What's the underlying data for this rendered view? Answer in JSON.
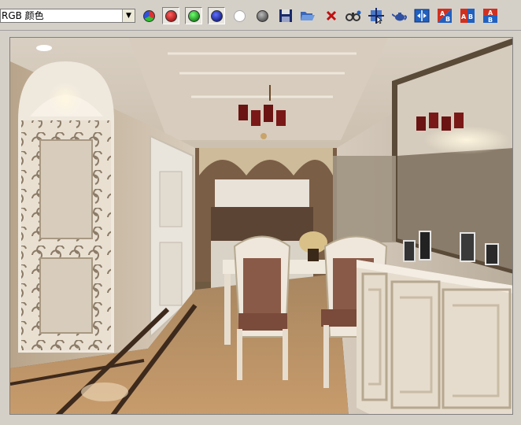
{
  "toolbar": {
    "channel_select": {
      "value": "RGB 颜色"
    },
    "buttons": [
      {
        "name": "rgb-channel-icon",
        "icon": "rgb-circle"
      },
      {
        "name": "red-channel-icon",
        "icon": "red-circle"
      },
      {
        "name": "green-channel-icon",
        "icon": "green-circle"
      },
      {
        "name": "blue-channel-icon",
        "icon": "blue-circle"
      },
      {
        "name": "mono-icon",
        "icon": "white-circle"
      },
      {
        "name": "clear-icon",
        "icon": "gray-circle"
      },
      {
        "name": "save-icon",
        "icon": "floppy"
      },
      {
        "name": "open-icon",
        "icon": "folder"
      },
      {
        "name": "close-icon",
        "icon": "red-x"
      },
      {
        "name": "compare-icon",
        "icon": "binoculars"
      },
      {
        "name": "region-icon",
        "icon": "crosshair"
      },
      {
        "name": "teapot-icon",
        "icon": "teapot"
      },
      {
        "name": "ab-compare-icon",
        "icon": "split-ab"
      },
      {
        "name": "ab-vertical-icon",
        "icon": "ab-diagonal"
      },
      {
        "name": "ab-horizontal-icon",
        "icon": "ab-side"
      },
      {
        "name": "ab-stack-icon",
        "icon": "ab-top"
      }
    ],
    "label_a": "A",
    "label_b": "B"
  },
  "colors": {
    "toolbar_bg": "#d4d0c8",
    "red": "#b01818",
    "green": "#18a018",
    "blue": "#102080",
    "accent_blue": "#2060c0"
  }
}
